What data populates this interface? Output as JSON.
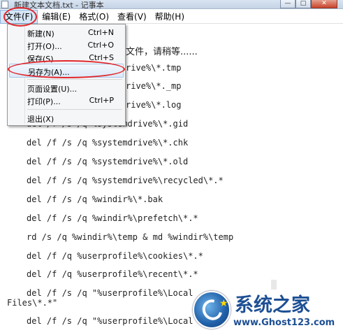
{
  "window": {
    "title": "新建文本文档.txt - 记事本",
    "buttons": {
      "minimize": "—",
      "maximize": "□",
      "close": "✕"
    }
  },
  "menubar": {
    "items": [
      "文件(F)",
      "编辑(E)",
      "格式(O)",
      "查看(V)",
      "帮助(H)"
    ],
    "active_index": 0
  },
  "file_menu": {
    "items": [
      {
        "label": "新建(N)",
        "shortcut": "Ctrl+N"
      },
      {
        "label": "打开(O)...",
        "shortcut": "Ctrl+O"
      },
      {
        "label": "保存(S)",
        "shortcut": "Ctrl+S"
      },
      {
        "label": "另存为(A)...",
        "shortcut": ""
      },
      {
        "label": "页面设置(U)...",
        "shortcut": ""
      },
      {
        "label": "打印(P)...",
        "shortcut": "Ctrl+P"
      },
      {
        "label": "退出(X)",
        "shortcut": ""
      }
    ],
    "highlighted": "另存为(A)..."
  },
  "editor": {
    "lines": [
      "文件，请稍等......",
      "rive%\\*.tmp",
      "rive%\\*._mp",
      "rive%\\*.log",
      "del /f /s /q %systemdrive%\\*.gid",
      "del /f /s /q %systemdrive%\\*.chk",
      "del /f /s /q %systemdrive%\\*.old",
      "del /f /s /q %systemdrive%\\recycled\\*.*",
      "del /f /s /q %windir%\\*.bak",
      "del /f /s /q %windir%\\prefetch\\*.*",
      "rd /s /q %windir%\\temp & md %windir%\\temp",
      "del /f /q %userprofile%\\cookies\\*.*",
      "del /f /q %userprofile%\\recent\\*.*",
      "del /f /s /q \"%userprofile%\\Local",
      "Files\\*.*\"",
      "del /f /s /q \"%userprofile%\\Local"
    ]
  },
  "watermark": {
    "title": "系统之家",
    "url": "www.Ghost123.com"
  },
  "colors": {
    "annotation": "#e0262a",
    "menu_highlight": "#dce9f8",
    "watermark_blue": "#1d4f94"
  }
}
